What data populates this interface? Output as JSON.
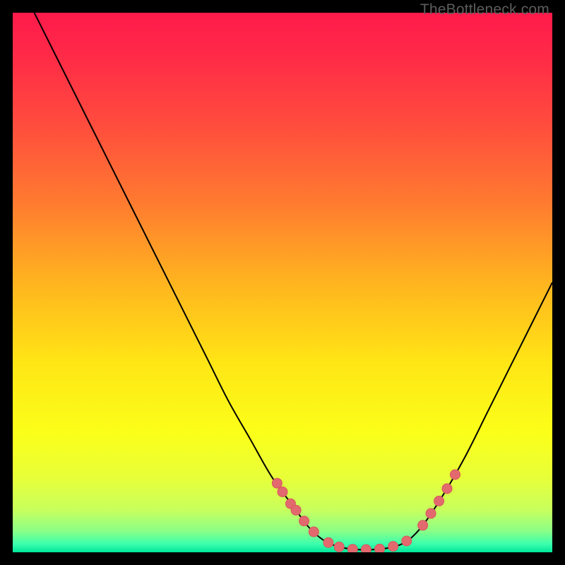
{
  "watermark": "TheBottleneck.com",
  "colors": {
    "gradient_stops": [
      {
        "offset": 0.0,
        "color": "#ff1a4b"
      },
      {
        "offset": 0.08,
        "color": "#ff2a47"
      },
      {
        "offset": 0.2,
        "color": "#ff4a3e"
      },
      {
        "offset": 0.35,
        "color": "#ff7a30"
      },
      {
        "offset": 0.5,
        "color": "#ffb41f"
      },
      {
        "offset": 0.65,
        "color": "#ffe615"
      },
      {
        "offset": 0.78,
        "color": "#fbff19"
      },
      {
        "offset": 0.86,
        "color": "#e8ff38"
      },
      {
        "offset": 0.92,
        "color": "#c9ff5c"
      },
      {
        "offset": 0.96,
        "color": "#8cff86"
      },
      {
        "offset": 0.985,
        "color": "#3affad"
      },
      {
        "offset": 1.0,
        "color": "#00e59a"
      }
    ],
    "curve": "#000000",
    "marker_fill": "#e26a6e",
    "marker_stroke": "#d8575c"
  },
  "chart_data": {
    "type": "line",
    "title": "",
    "xlabel": "",
    "ylabel": "",
    "xlim": [
      0,
      100
    ],
    "ylim": [
      0,
      100
    ],
    "curve": [
      {
        "x": 4,
        "y": 100
      },
      {
        "x": 8,
        "y": 92
      },
      {
        "x": 12,
        "y": 84
      },
      {
        "x": 16,
        "y": 76
      },
      {
        "x": 20,
        "y": 68
      },
      {
        "x": 24,
        "y": 60
      },
      {
        "x": 28,
        "y": 52
      },
      {
        "x": 32,
        "y": 44
      },
      {
        "x": 36,
        "y": 36
      },
      {
        "x": 40,
        "y": 28
      },
      {
        "x": 44,
        "y": 21
      },
      {
        "x": 48,
        "y": 14
      },
      {
        "x": 52,
        "y": 8.5
      },
      {
        "x": 55,
        "y": 4.5
      },
      {
        "x": 58,
        "y": 2.0
      },
      {
        "x": 61,
        "y": 0.9
      },
      {
        "x": 64,
        "y": 0.5
      },
      {
        "x": 67,
        "y": 0.5
      },
      {
        "x": 70,
        "y": 0.9
      },
      {
        "x": 73,
        "y": 2.0
      },
      {
        "x": 76,
        "y": 5.0
      },
      {
        "x": 80,
        "y": 11
      },
      {
        "x": 84,
        "y": 18
      },
      {
        "x": 88,
        "y": 26
      },
      {
        "x": 92,
        "y": 34
      },
      {
        "x": 96,
        "y": 42
      },
      {
        "x": 100,
        "y": 50
      }
    ],
    "markers": [
      {
        "x": 49.0,
        "y": 12.8
      },
      {
        "x": 50.0,
        "y": 11.2
      },
      {
        "x": 51.5,
        "y": 9.0
      },
      {
        "x": 52.5,
        "y": 7.8
      },
      {
        "x": 54.0,
        "y": 5.8
      },
      {
        "x": 55.8,
        "y": 3.8
      },
      {
        "x": 58.5,
        "y": 1.8
      },
      {
        "x": 60.5,
        "y": 1.0
      },
      {
        "x": 63.0,
        "y": 0.55
      },
      {
        "x": 65.5,
        "y": 0.5
      },
      {
        "x": 68.0,
        "y": 0.6
      },
      {
        "x": 70.5,
        "y": 1.1
      },
      {
        "x": 73.0,
        "y": 2.1
      },
      {
        "x": 76.0,
        "y": 5.0
      },
      {
        "x": 77.5,
        "y": 7.2
      },
      {
        "x": 79.0,
        "y": 9.5
      },
      {
        "x": 80.5,
        "y": 11.8
      },
      {
        "x": 82.0,
        "y": 14.4
      }
    ]
  }
}
